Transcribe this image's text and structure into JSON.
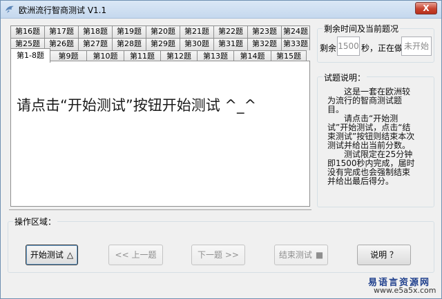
{
  "window": {
    "title": "欧洲流行智商测试 V1.1",
    "close_label": "X"
  },
  "tabs": {
    "row1": [
      "第16题",
      "第17题",
      "第18题",
      "第19题",
      "第20题",
      "第21题",
      "第22题",
      "第23题",
      "第24题"
    ],
    "row2": [
      "第25题",
      "第26题",
      "第27题",
      "第28题",
      "第29题",
      "第30题",
      "第31题",
      "第32题",
      "第33题"
    ],
    "row3": [
      "第1-8题",
      "第9题",
      "第10题",
      "第11题",
      "第12题",
      "第13题",
      "第14题",
      "第15题"
    ],
    "active": "第1-8题"
  },
  "main": {
    "prompt": "请点击“开始测试”按钮开始测试 ^_^"
  },
  "status": {
    "group_title": "剩余时间及当前题况",
    "remaining_label": "剩余",
    "remaining_value": "1500",
    "unit_label": "秒，正在做",
    "current_value": "未开始"
  },
  "description": {
    "group_title": "试题说明：",
    "paragraphs": [
      "这是一套在欧洲较为流行的智商测试题目。",
      "请点击“开始测试”开始测试，点击“结束测试”按钮则结束本次测试并给出当前分数。",
      "测试限定在25分钟即1500秒内完成，届时没有完成也会强制结束并给出最后得分。"
    ]
  },
  "operations": {
    "group_title": "操作区域：",
    "buttons": {
      "start": "开始测试",
      "start_icon": "△",
      "prev": "<< 上一题",
      "next": "下一题 >>",
      "end": "结束测试",
      "end_icon": "■",
      "help": "说明 ？"
    }
  },
  "watermark": {
    "line1": "易语言资源网",
    "line2": "www.e5a5x.com"
  }
}
